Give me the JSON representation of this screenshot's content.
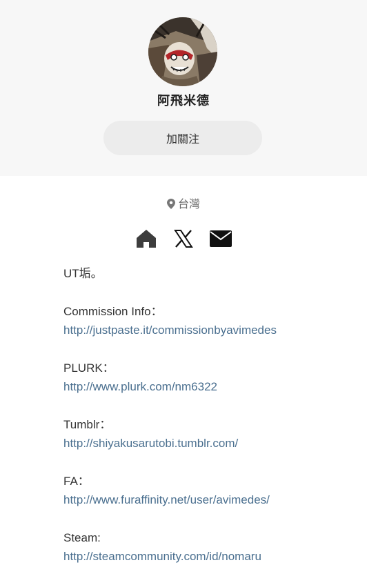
{
  "profile": {
    "name": "阿飛米德",
    "follow_label": "加關注",
    "location": "台灣"
  },
  "socials": [
    {
      "icon": "home-icon"
    },
    {
      "icon": "x-logo-icon"
    },
    {
      "icon": "mail-icon"
    }
  ],
  "bio": {
    "intro": "UT垢。",
    "commission_label": "Commission Info：",
    "commission_url": "http://justpaste.it/commissionbyavimedes",
    "plurk_label": "PLURK：",
    "plurk_url": "http://www.plurk.com/nm6322",
    "tumblr_label": "Tumblr：",
    "tumblr_url": "http://shiyakusarutobi.tumblr.com/",
    "fa_label": "FA：",
    "fa_url": "http://www.furaffinity.net/user/avimedes/",
    "steam_label": "Steam:",
    "steam_url": "http://steamcommunity.com/id/nomaru"
  },
  "colors": {
    "header_bg": "#f7f7f7",
    "button_bg": "#ececec",
    "link": "#4a6f8f",
    "text": "#333333",
    "muted": "#6b6b6b"
  }
}
